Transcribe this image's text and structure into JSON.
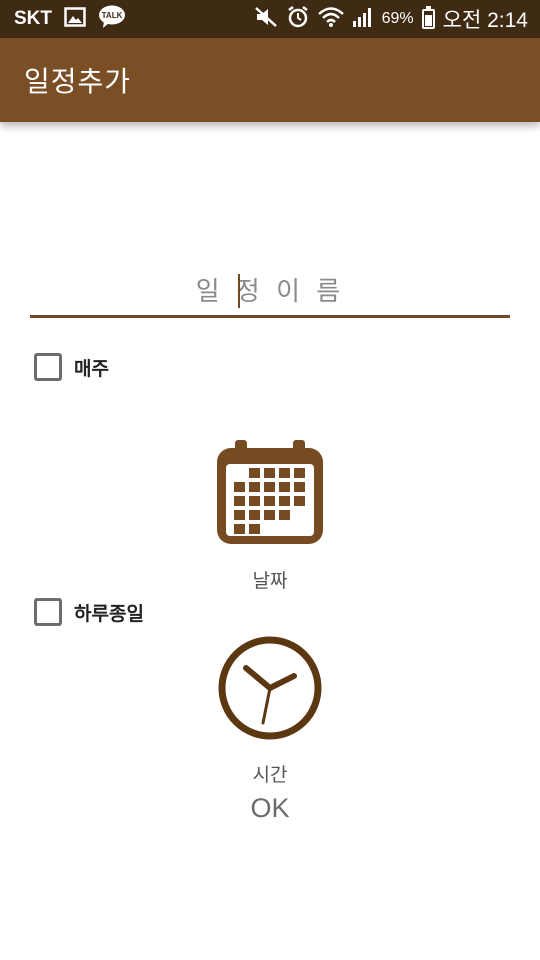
{
  "status_bar": {
    "carrier": "SKT",
    "battery_percent": "69%",
    "battery_level": 0.69,
    "time": "오전 2:14",
    "icons": [
      "gallery-icon",
      "kakaotalk-icon",
      "mute-icon",
      "alarm-icon",
      "wifi-icon",
      "signal-icon",
      "battery-icon"
    ],
    "talk_badge": "TALK"
  },
  "app_bar": {
    "title": "일정추가"
  },
  "form": {
    "name_placeholder": "일 정 이 름",
    "weekly_label": "매주",
    "weekly_checked": false,
    "allday_label": "하루종일",
    "allday_checked": false,
    "date_label": "날짜",
    "time_label": "시간",
    "ok_label": "OK"
  },
  "colors": {
    "status_bar": "#3f2a14",
    "app_bar": "#7a4f25",
    "icon_brown": "#774b22",
    "underline": "#6f4a22"
  }
}
